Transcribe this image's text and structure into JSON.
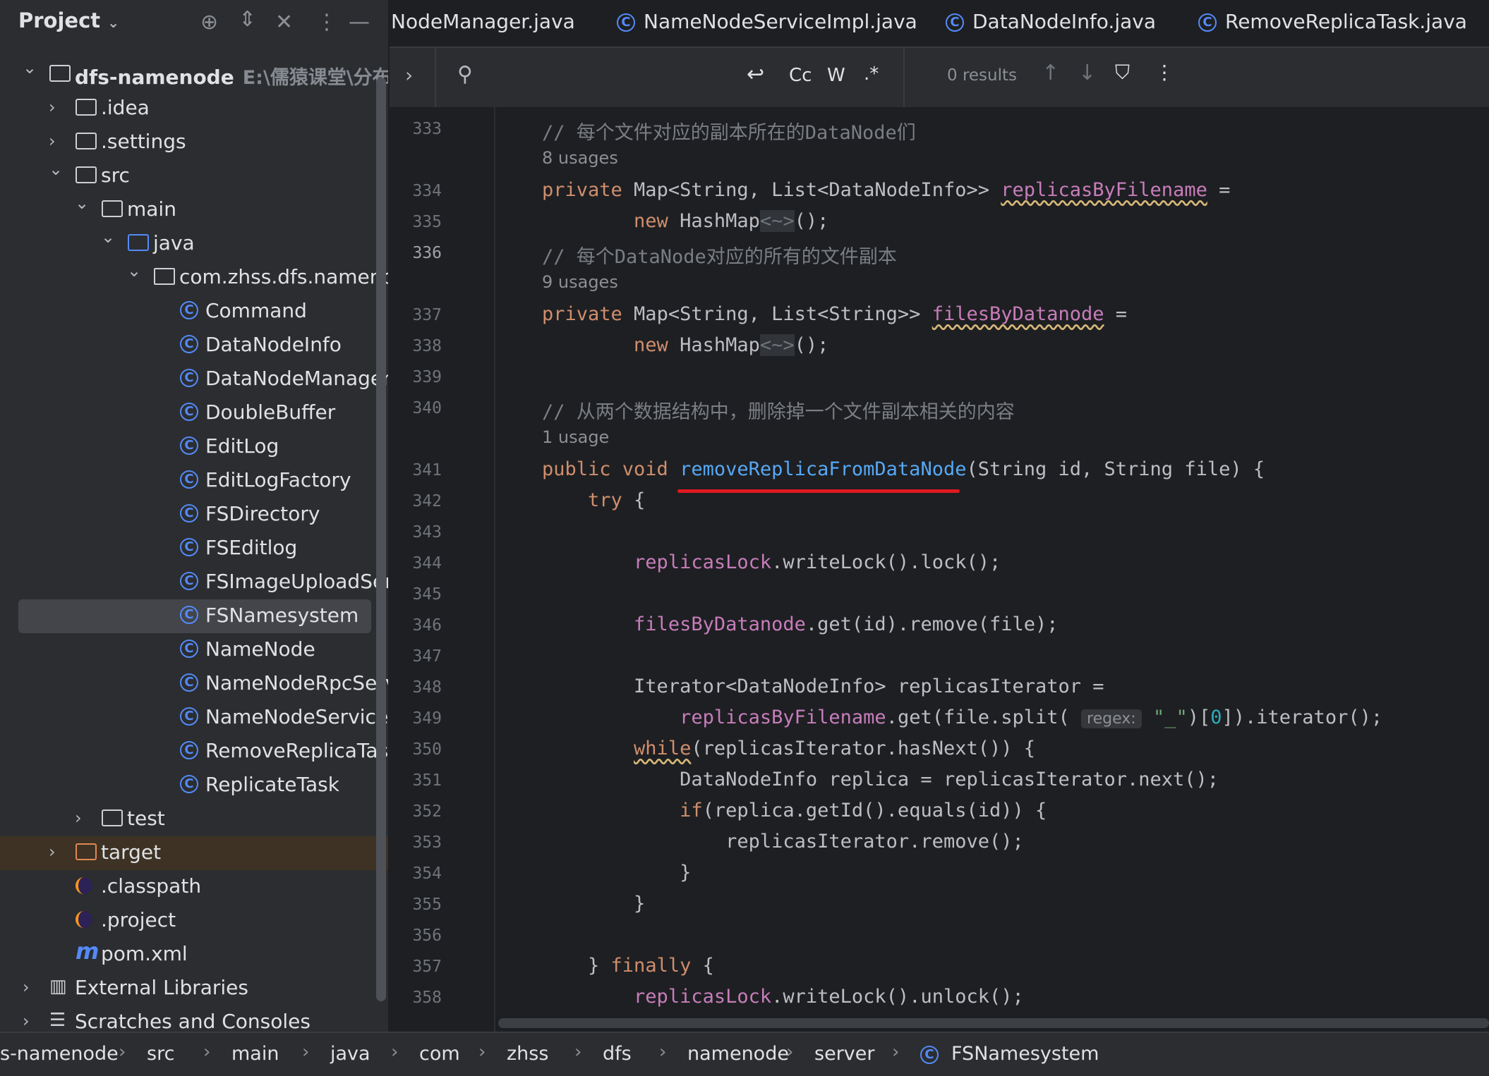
{
  "sidebar": {
    "title": "Project",
    "tree": [
      {
        "label": "dfs-namenode",
        "sub": "E:\\儒猿课堂\\分布式文",
        "kind": "module",
        "indent": 0,
        "chev": "down",
        "bold": true
      },
      {
        "label": ".idea",
        "kind": "folder",
        "indent": 1,
        "chev": "right"
      },
      {
        "label": ".settings",
        "kind": "folder",
        "indent": 1,
        "chev": "right"
      },
      {
        "label": "src",
        "kind": "folder",
        "indent": 1,
        "chev": "down"
      },
      {
        "label": "main",
        "kind": "folder",
        "indent": 2,
        "chev": "down"
      },
      {
        "label": "java",
        "kind": "srcfolder",
        "indent": 3,
        "chev": "down"
      },
      {
        "label": "com.zhss.dfs.namenode",
        "kind": "package",
        "indent": 4,
        "chev": "down"
      },
      {
        "label": "Command",
        "kind": "class",
        "indent": 5
      },
      {
        "label": "DataNodeInfo",
        "kind": "class",
        "indent": 5
      },
      {
        "label": "DataNodeManager",
        "kind": "class",
        "indent": 5
      },
      {
        "label": "DoubleBuffer",
        "kind": "class",
        "indent": 5
      },
      {
        "label": "EditLog",
        "kind": "class",
        "indent": 5
      },
      {
        "label": "EditLogFactory",
        "kind": "class",
        "indent": 5
      },
      {
        "label": "FSDirectory",
        "kind": "class",
        "indent": 5
      },
      {
        "label": "FSEditlog",
        "kind": "class",
        "indent": 5
      },
      {
        "label": "FSImageUploadServer",
        "kind": "class",
        "indent": 5
      },
      {
        "label": "FSNamesystem",
        "kind": "class",
        "indent": 5,
        "selected": true
      },
      {
        "label": "NameNode",
        "kind": "class",
        "indent": 5
      },
      {
        "label": "NameNodeRpcServer",
        "kind": "class",
        "indent": 5
      },
      {
        "label": "NameNodeServiceImpl",
        "kind": "class",
        "indent": 5
      },
      {
        "label": "RemoveReplicaTask",
        "kind": "class",
        "indent": 5
      },
      {
        "label": "ReplicateTask",
        "kind": "class",
        "indent": 5
      },
      {
        "label": "test",
        "kind": "folder",
        "indent": 2,
        "chev": "right"
      },
      {
        "label": "target",
        "kind": "excluded",
        "indent": 1,
        "chev": "right",
        "highlight": true
      },
      {
        "label": ".classpath",
        "kind": "eclipse",
        "indent": 1
      },
      {
        "label": ".project",
        "kind": "eclipse",
        "indent": 1
      },
      {
        "label": "pom.xml",
        "kind": "maven",
        "indent": 1
      },
      {
        "label": "External Libraries",
        "kind": "libs",
        "indent": 0,
        "chev": "right"
      },
      {
        "label": "Scratches and Consoles",
        "kind": "scratch",
        "indent": 0,
        "chev": "right"
      }
    ]
  },
  "tabs": [
    "NodeManager.java",
    "NameNodeServiceImpl.java",
    "DataNodeInfo.java",
    "RemoveReplicaTask.java"
  ],
  "search": {
    "options": [
      "Cc",
      "W",
      ".*"
    ],
    "results": "0 results"
  },
  "editor": {
    "current_line": "336",
    "lines": [
      {
        "n": "333",
        "html": "<span class=\"cm\">// 每个文件对应的副本所在的DataNode们</span>",
        "indent": 1
      },
      {
        "usage": "8 usages",
        "indent": 1
      },
      {
        "n": "334",
        "html": "<span class=\"kw\">private</span> Map&lt;String, List&lt;DataNodeInfo&gt;&gt; <span class=\"fld wavy\">replicasByFilename</span> =",
        "indent": 1
      },
      {
        "n": "335",
        "html": "        <span class=\"kw\">new</span> HashMap<span class=\"dim\">&lt;~&gt;</span>();",
        "indent": 1
      },
      {
        "n": "336",
        "html": "<span class=\"cm\">// 每个DataNode对应的所有的文件副本</span>",
        "indent": 1
      },
      {
        "usage": "9 usages",
        "indent": 1
      },
      {
        "n": "337",
        "html": "<span class=\"kw\">private</span> Map&lt;String, List&lt;String&gt;&gt; <span class=\"fld wavy\">filesByDatanode</span> =",
        "indent": 1
      },
      {
        "n": "338",
        "html": "        <span class=\"kw\">new</span> HashMap<span class=\"dim\">&lt;~&gt;</span>();",
        "indent": 1
      },
      {
        "n": "339",
        "html": "",
        "indent": 1
      },
      {
        "n": "340",
        "html": "<span class=\"cm\">// 从两个数据结构中，删除掉一个文件副本相关的内容</span>",
        "indent": 1
      },
      {
        "usage": "1 usage",
        "indent": 1
      },
      {
        "n": "341",
        "html": "<span class=\"kw\">public void</span> <span class=\"fn\">removeReplicaFromDataNode</span>(String id, String file) {",
        "indent": 1
      },
      {
        "n": "342",
        "html": "    <span class=\"kw\">try</span> {",
        "indent": 1
      },
      {
        "n": "343",
        "html": "",
        "indent": 1
      },
      {
        "n": "344",
        "html": "        <span class=\"fld\">replicasLock</span>.writeLock().lock();",
        "indent": 1
      },
      {
        "n": "345",
        "html": "",
        "indent": 1
      },
      {
        "n": "346",
        "html": "        <span class=\"fld\">filesByDatanode</span>.get(id).remove(file);",
        "indent": 1
      },
      {
        "n": "347",
        "html": "",
        "indent": 1
      },
      {
        "n": "348",
        "html": "        Iterator&lt;DataNodeInfo&gt; replicasIterator =",
        "indent": 1
      },
      {
        "n": "349",
        "html": "            <span class=\"fld\">replicasByFilename</span>.get(file.split( <span class=\"hint\">regex:</span> <span style=\"color:#6aab73\">\"_\"</span>)[<span class=\"num\">0</span>]).iterator();",
        "indent": 1
      },
      {
        "n": "350",
        "html": "        <span class=\"kw wavy\">while</span>(replicasIterator.hasNext()) {",
        "indent": 1
      },
      {
        "n": "351",
        "html": "            DataNodeInfo replica = replicasIterator.next();",
        "indent": 1
      },
      {
        "n": "352",
        "html": "            <span class=\"kw\">if</span>(replica.getId().equals(id)) {",
        "indent": 1
      },
      {
        "n": "353",
        "html": "                replicasIterator.remove();",
        "indent": 1
      },
      {
        "n": "354",
        "html": "            }",
        "indent": 1
      },
      {
        "n": "355",
        "html": "        }",
        "indent": 1
      },
      {
        "n": "356",
        "html": "",
        "indent": 1
      },
      {
        "n": "357",
        "html": "    } <span class=\"kw\">finally</span> {",
        "indent": 1
      },
      {
        "n": "358",
        "html": "        <span class=\"fld\">replicasLock</span>.writeLock().unlock();",
        "indent": 1
      }
    ]
  },
  "breadcrumb": [
    "s-namenode",
    "src",
    "main",
    "java",
    "com",
    "zhss",
    "dfs",
    "namenode",
    "server",
    "FSNamesystem"
  ],
  "colors": {
    "accent": "#548af7",
    "annotation": "#e0191f"
  }
}
